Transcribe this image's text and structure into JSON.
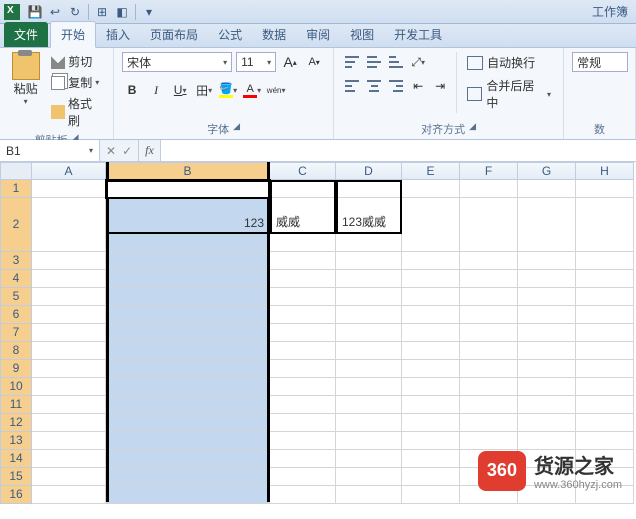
{
  "title": "工作簿",
  "qat": {
    "save": "💾",
    "undo": "↩",
    "redo": "↪",
    "more": "▾"
  },
  "tabs": {
    "file": "文件",
    "home": "开始",
    "insert": "插入",
    "layout": "页面布局",
    "formulas": "公式",
    "data": "数据",
    "review": "审阅",
    "view": "视图",
    "dev": "开发工具"
  },
  "clipboard": {
    "paste": "粘贴",
    "cut": "剪切",
    "copy": "复制",
    "brush": "格式刷",
    "label": "剪贴板"
  },
  "font": {
    "name": "宋体",
    "size": "11",
    "grow": "A",
    "shrink": "A",
    "bold": "B",
    "italic": "I",
    "underline": "U",
    "label": "字体"
  },
  "align": {
    "wrap": "自动换行",
    "merge": "合并后居中",
    "label": "对齐方式"
  },
  "number": {
    "general": "常规",
    "label": "数"
  },
  "namebox": "B1",
  "fx": "fx",
  "cols": [
    "A",
    "B",
    "C",
    "D",
    "E",
    "F",
    "G",
    "H"
  ],
  "rows": [
    "1",
    "2",
    "3",
    "4",
    "5",
    "6",
    "7",
    "8",
    "9",
    "10",
    "11",
    "12",
    "13",
    "14",
    "15",
    "16"
  ],
  "cells": {
    "B2": "123",
    "C2": "威威",
    "D2": "123威威"
  },
  "wm": {
    "badge": "360",
    "name": "货源之家",
    "url": "www.360hyzj.com"
  }
}
